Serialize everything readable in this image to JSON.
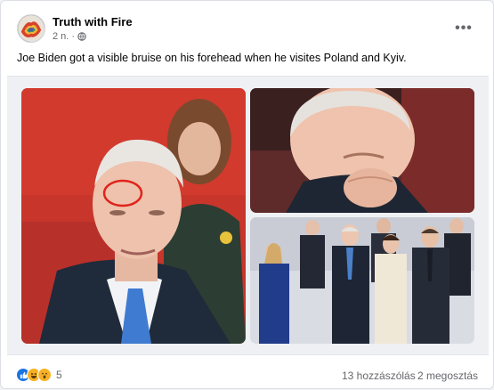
{
  "post": {
    "page_name": "Truth with Fire",
    "time": "2 n.",
    "separator": "·",
    "text": "Joe Biden got a visible bruise on his forehead when he visites Poland and Kyiv.",
    "menu_glyph": "•••"
  },
  "media": {
    "photos": [
      {
        "subject": "close-up-with-red-circle-on-forehead"
      },
      {
        "subject": "close-up-hand-on-chin"
      },
      {
        "subject": "group-photo-of-leaders"
      }
    ]
  },
  "footer": {
    "reactions": [
      "like-icon",
      "haha-icon",
      "wow-icon"
    ],
    "reaction_count": "5",
    "comments": "13 hozzászólás",
    "shares": "2 megosztás"
  },
  "colors": {
    "brand_blue": "#1b74e4",
    "annotation_red": "#e0231c",
    "secondary_text": "#65676b"
  }
}
